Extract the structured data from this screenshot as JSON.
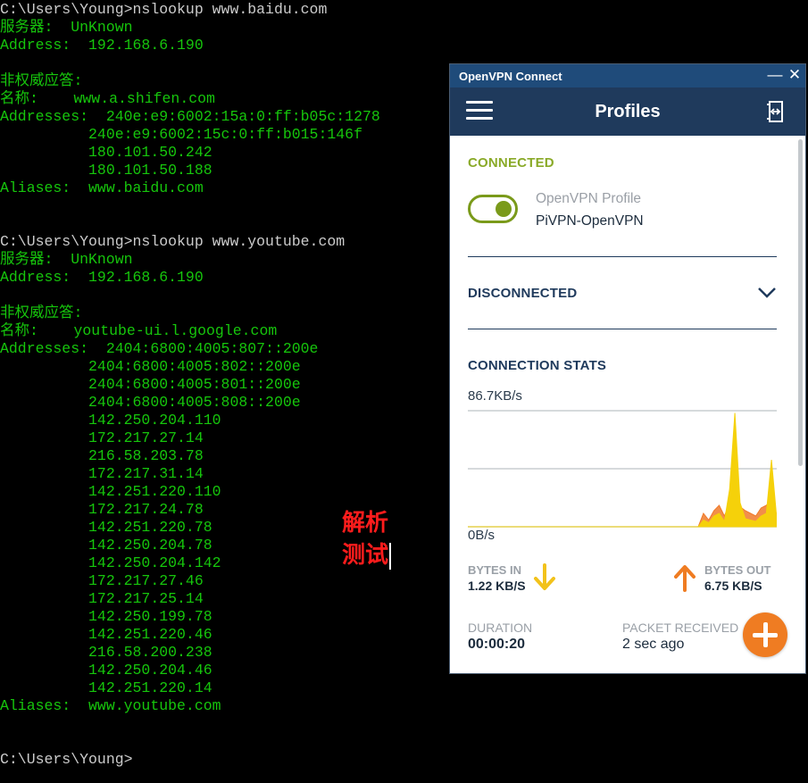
{
  "terminal": {
    "lines": [
      {
        "text": "C:\\Users\\Young>nslookup www.baidu.com",
        "style": "prompt"
      },
      {
        "text": "服务器:  UnKnown",
        "style": "output"
      },
      {
        "text": "Address:  192.168.6.190",
        "style": "output"
      },
      {
        "text": "",
        "style": "output"
      },
      {
        "text": "非权威应答:",
        "style": "output"
      },
      {
        "text": "名称:    www.a.shifen.com",
        "style": "output"
      },
      {
        "text": "Addresses:  240e:e9:6002:15a:0:ff:b05c:1278",
        "style": "output"
      },
      {
        "text": "          240e:e9:6002:15c:0:ff:b015:146f",
        "style": "output"
      },
      {
        "text": "          180.101.50.242",
        "style": "output"
      },
      {
        "text": "          180.101.50.188",
        "style": "output"
      },
      {
        "text": "Aliases:  www.baidu.com",
        "style": "output"
      },
      {
        "text": "",
        "style": "output"
      },
      {
        "text": "",
        "style": "output"
      },
      {
        "text": "C:\\Users\\Young>nslookup www.youtube.com",
        "style": "prompt"
      },
      {
        "text": "服务器:  UnKnown",
        "style": "output"
      },
      {
        "text": "Address:  192.168.6.190",
        "style": "output"
      },
      {
        "text": "",
        "style": "output"
      },
      {
        "text": "非权威应答:",
        "style": "output"
      },
      {
        "text": "名称:    youtube-ui.l.google.com",
        "style": "output"
      },
      {
        "text": "Addresses:  2404:6800:4005:807::200e",
        "style": "output"
      },
      {
        "text": "          2404:6800:4005:802::200e",
        "style": "output"
      },
      {
        "text": "          2404:6800:4005:801::200e",
        "style": "output"
      },
      {
        "text": "          2404:6800:4005:808::200e",
        "style": "output"
      },
      {
        "text": "          142.250.204.110",
        "style": "output"
      },
      {
        "text": "          172.217.27.14",
        "style": "output"
      },
      {
        "text": "          216.58.203.78",
        "style": "output"
      },
      {
        "text": "          172.217.31.14",
        "style": "output"
      },
      {
        "text": "          142.251.220.110",
        "style": "output"
      },
      {
        "text": "          172.217.24.78",
        "style": "output"
      },
      {
        "text": "          142.251.220.78",
        "style": "output"
      },
      {
        "text": "          142.250.204.78",
        "style": "output"
      },
      {
        "text": "          142.250.204.142",
        "style": "output"
      },
      {
        "text": "          172.217.27.46",
        "style": "output"
      },
      {
        "text": "          172.217.25.14",
        "style": "output"
      },
      {
        "text": "          142.250.199.78",
        "style": "output"
      },
      {
        "text": "          142.251.220.46",
        "style": "output"
      },
      {
        "text": "          216.58.200.238",
        "style": "output"
      },
      {
        "text": "          142.250.204.46",
        "style": "output"
      },
      {
        "text": "          142.251.220.14",
        "style": "output"
      },
      {
        "text": "Aliases:  www.youtube.com",
        "style": "output"
      },
      {
        "text": "",
        "style": "output"
      },
      {
        "text": "",
        "style": "output"
      },
      {
        "text": "C:\\Users\\Young>",
        "style": "prompt"
      }
    ],
    "colors": {
      "output": "#16c60c",
      "prompt": "#cccccc",
      "background": "#000000"
    }
  },
  "annotation": {
    "line1": "解析",
    "line2": "测试",
    "color": "#ff1c1c"
  },
  "vpn": {
    "window_title": "OpenVPN Connect",
    "minimize_glyph": "—",
    "close_glyph": "✕",
    "header_title": "Profiles",
    "connected_label": "CONNECTED",
    "profile_subtitle": "OpenVPN Profile",
    "profile_name": "PiVPN-OpenVPN",
    "disconnected_label": "DISCONNECTED",
    "stats_label": "CONNECTION STATS",
    "chart_max_label": "86.7KB/s",
    "chart_min_label": "0B/s",
    "bytes_in_caption": "BYTES IN",
    "bytes_in_value": "1.22 KB/S",
    "bytes_out_caption": "BYTES OUT",
    "bytes_out_value": "6.75 KB/S",
    "duration_caption": "DURATION",
    "duration_value": "00:00:20",
    "packet_caption": "PACKET RECEIVED",
    "packet_value": "2 sec ago",
    "icons": {
      "menu": "hamburger-menu-icon",
      "import": "import-profile-icon",
      "expand": "chevron-down-icon",
      "bytes_in": "arrow-down-icon",
      "bytes_out": "arrow-up-icon",
      "add": "plus-icon"
    },
    "colors": {
      "titlebar": "#1f4b7a",
      "header": "#1f3a5c",
      "connected": "#8aaa29",
      "toggle": "#7a9a1a",
      "bytes_in_arrow": "#f2c21b",
      "bytes_out_arrow": "#ef7c22",
      "fab": "#ef7c22",
      "chart_in": "#f5d10a",
      "chart_out": "#f07a2a"
    }
  },
  "chart_data": {
    "type": "area",
    "ylim": [
      0,
      86.7
    ],
    "ytick_labels": [
      "86.7KB/s",
      "0B/s"
    ],
    "x": [
      0,
      1,
      2,
      3,
      4,
      5,
      6,
      7,
      8,
      9,
      10,
      11,
      12,
      13,
      14,
      15,
      16,
      17,
      18,
      19,
      20,
      21,
      22,
      23,
      24,
      25,
      26,
      27,
      28,
      29,
      30,
      31,
      32,
      33,
      34,
      35,
      36,
      37,
      38,
      39,
      40,
      41,
      42,
      43,
      44,
      45,
      46,
      47,
      48,
      49,
      50,
      51,
      52,
      53,
      54,
      55,
      56,
      57,
      58,
      59
    ],
    "series": [
      {
        "values": [
          0,
          0,
          0,
          0,
          0,
          0,
          0,
          0,
          0,
          0,
          0,
          0,
          0,
          0,
          0,
          0,
          0,
          0,
          0,
          0,
          0,
          0,
          0,
          0,
          0,
          0,
          0,
          0,
          0,
          0,
          0,
          0,
          0,
          0,
          0,
          0,
          0,
          0,
          0,
          0,
          0,
          0,
          0,
          0,
          0,
          5,
          3,
          8,
          10,
          4,
          28,
          85,
          18,
          6,
          5,
          4,
          8,
          10,
          50,
          6
        ]
      },
      {
        "values": [
          0,
          0,
          0,
          0,
          0,
          0,
          0,
          0,
          0,
          0,
          0,
          0,
          0,
          0,
          0,
          0,
          0,
          0,
          0,
          0,
          0,
          0,
          0,
          0,
          0,
          0,
          0,
          0,
          0,
          0,
          0,
          0,
          0,
          0,
          0,
          0,
          0,
          0,
          0,
          0,
          0,
          0,
          0,
          0,
          0,
          10,
          5,
          12,
          16,
          8,
          18,
          20,
          15,
          12,
          10,
          8,
          14,
          16,
          20,
          9
        ]
      }
    ]
  }
}
